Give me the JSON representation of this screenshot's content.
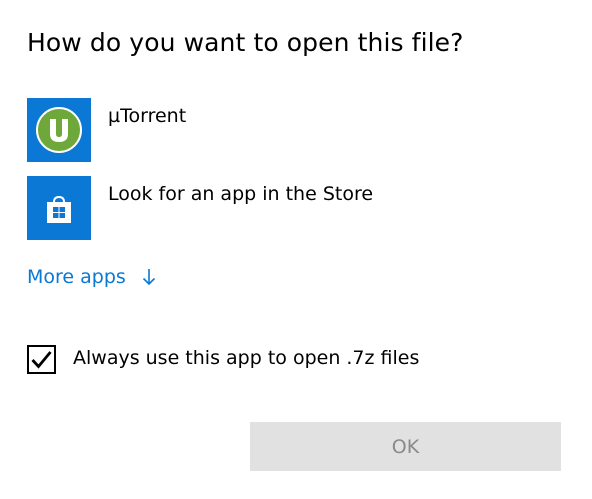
{
  "dialog": {
    "title": "How do you want to open this file?"
  },
  "apps": [
    {
      "label": "µTorrent",
      "icon": "utorrent-icon",
      "tile_color": "#0a78d4"
    },
    {
      "label": "Look for an app in the Store",
      "icon": "store-icon",
      "tile_color": "#0a78d4"
    }
  ],
  "more_apps": {
    "label": "More apps",
    "icon": "arrow-down-icon",
    "color": "#0a78d4"
  },
  "always_use": {
    "label": "Always use this app to open .7z files",
    "checked": true
  },
  "ok_button": {
    "label": "OK",
    "state": "disabled"
  }
}
